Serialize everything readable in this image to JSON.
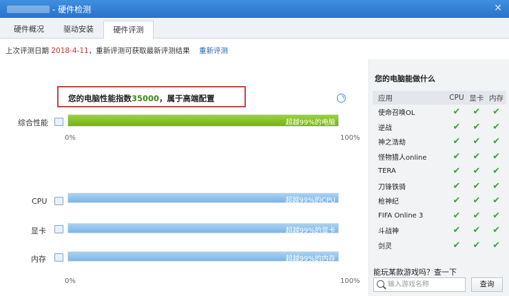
{
  "window": {
    "title": "- 硬件检测",
    "close_glyph": "✕"
  },
  "tabs": [
    {
      "label": "硬件概况"
    },
    {
      "label": "驱动安装"
    },
    {
      "label": "硬件评测"
    }
  ],
  "info": {
    "prefix": "上次评测日期",
    "date": "2018-4-11",
    "suffix": "，重新评测可获取最新评测结果",
    "link": "重新评测"
  },
  "score": {
    "before": "您的电脑性能指数",
    "value": "35000",
    "after": "，属于高端配置"
  },
  "axis": {
    "min": "0%",
    "max": "100%"
  },
  "bars": [
    {
      "label": "综合性能",
      "text": "超越99%的电脑",
      "percent": 100,
      "color": "green"
    },
    {
      "label": "CPU",
      "text": "超越99%的CPU",
      "percent": 100,
      "color": "blue"
    },
    {
      "label": "显卡",
      "text": "超越99%的显卡",
      "percent": 100,
      "color": "blue"
    },
    {
      "label": "内存",
      "text": "超越99%的内存",
      "percent": 100,
      "color": "blue"
    }
  ],
  "right": {
    "heading": "您的电脑能做什么",
    "columns": [
      "应用",
      "CPU",
      "显卡",
      "内存"
    ],
    "games": [
      "使命召唤OL",
      "逆战",
      "神之浩劫",
      "怪物猎人online",
      "TERA",
      "刀锋铁骑",
      "枪神纪",
      "FIFA Online 3",
      "斗战神",
      "剑灵"
    ],
    "check_glyph": "✔",
    "ask": "能玩某款游戏吗？查一下",
    "search_placeholder": "输入游戏名称",
    "query_button": "查询"
  }
}
